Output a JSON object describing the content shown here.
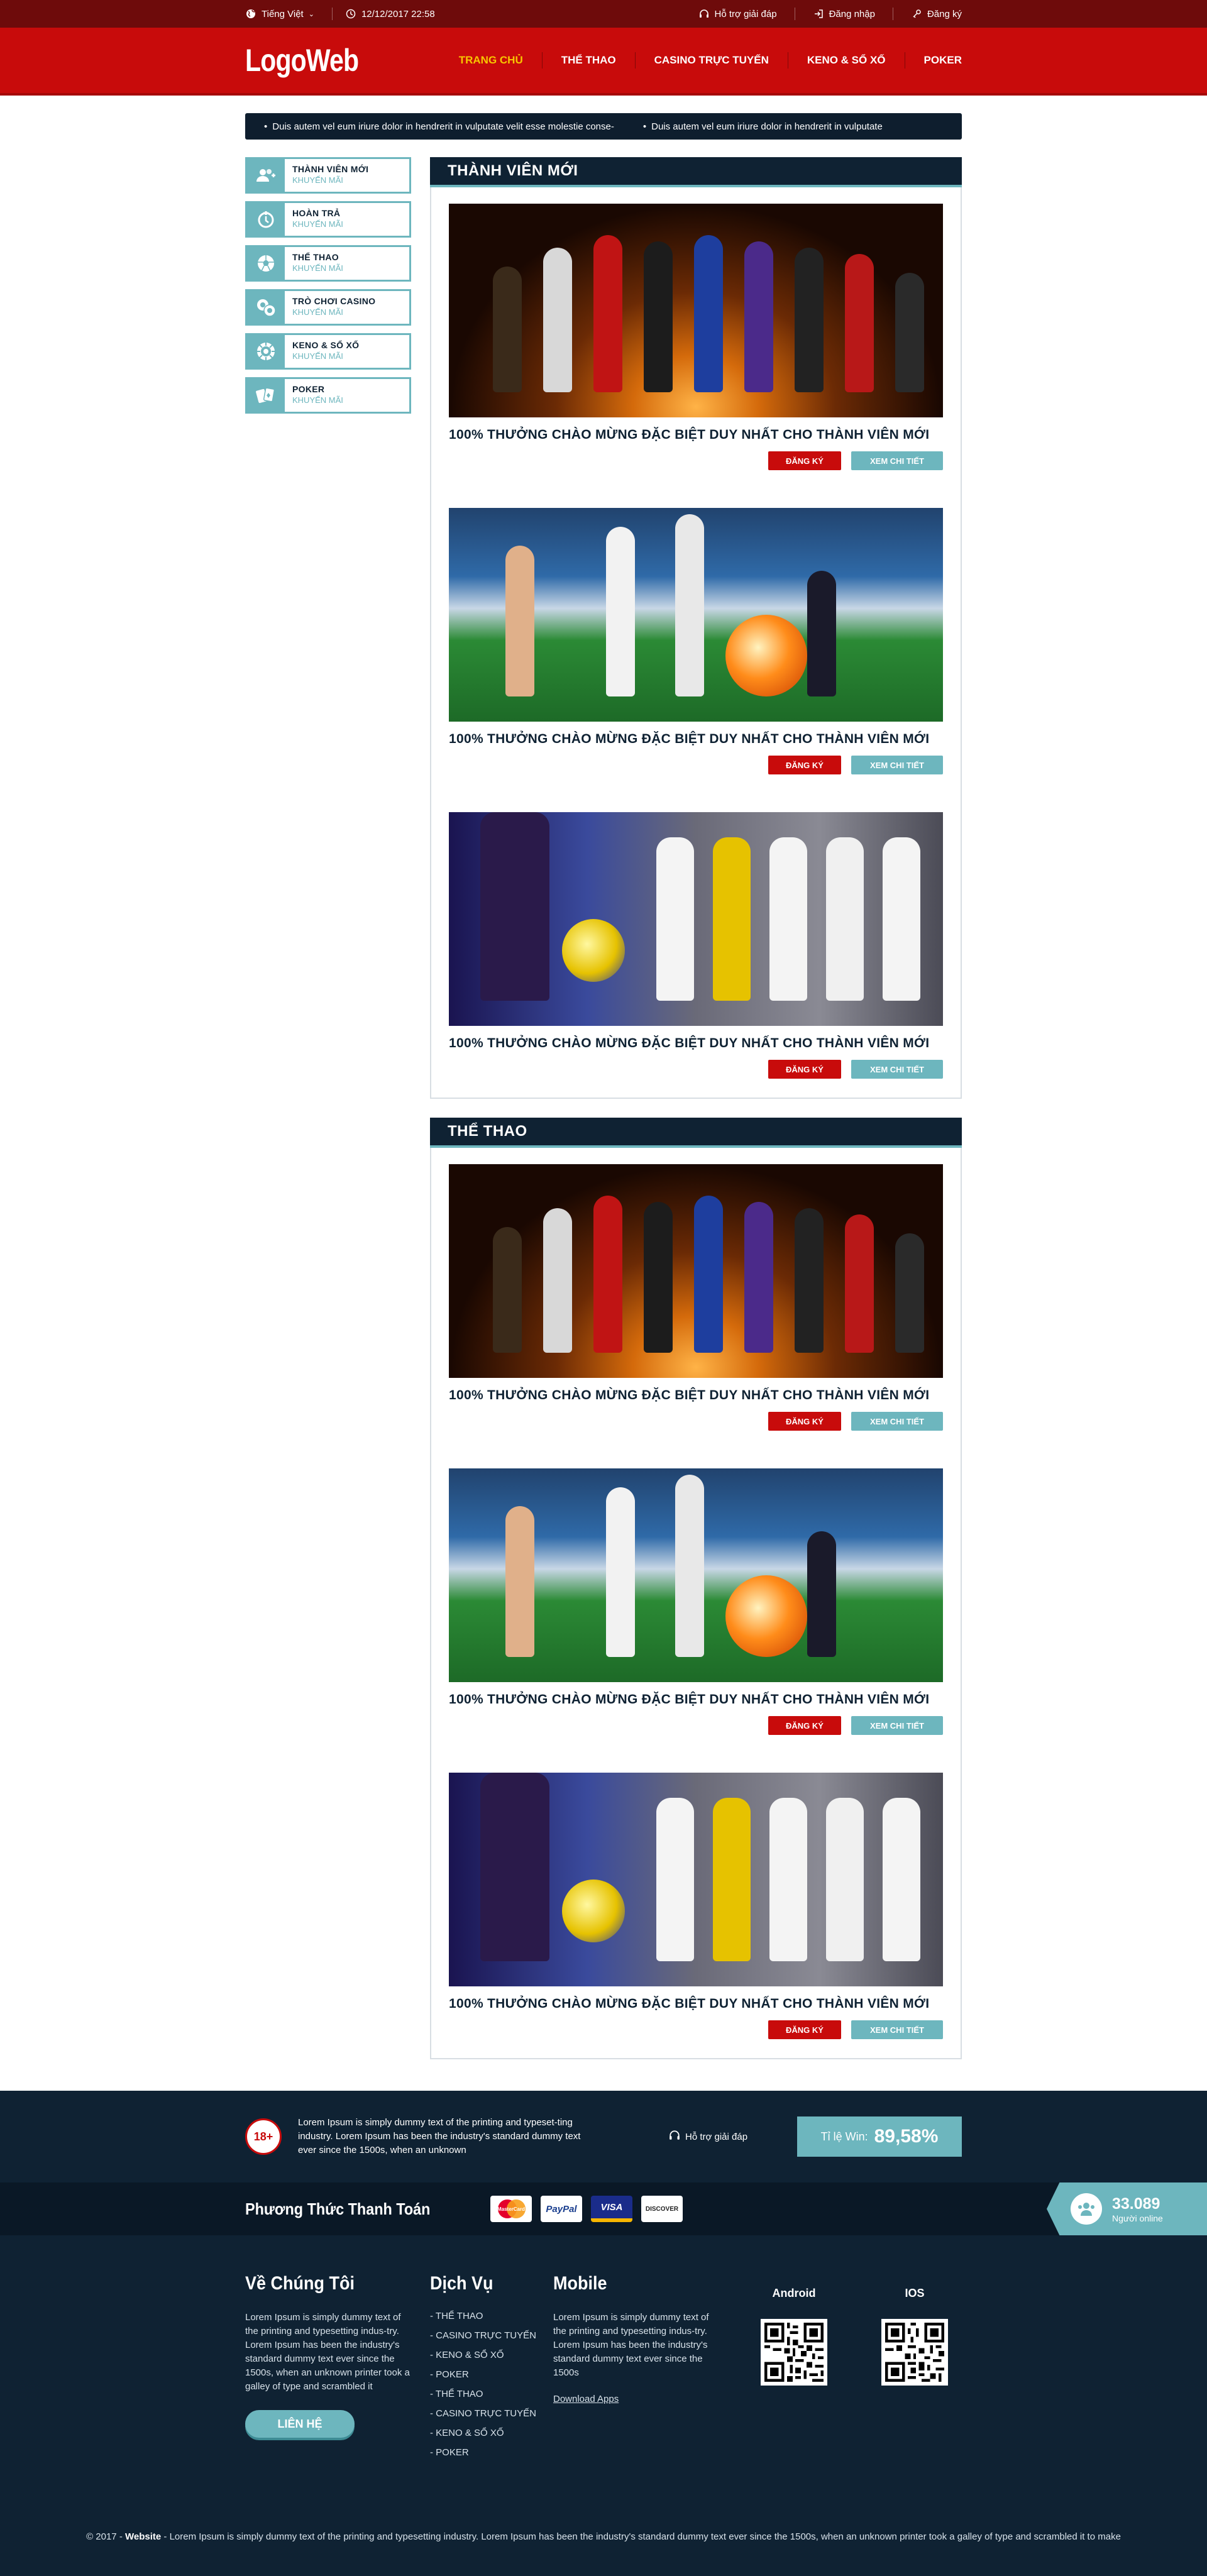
{
  "topbar": {
    "language": "Tiếng Việt",
    "datetime": "12/12/2017 22:58",
    "support": "Hỗ trợ giải đáp",
    "login": "Đăng nhập",
    "register": "Đăng ký"
  },
  "header": {
    "logo": "LogoWeb",
    "nav": [
      "TRANG CHỦ",
      "THỂ THAO",
      "CASINO TRỰC TUYẾN",
      "KENO & SỔ XỐ",
      "POKER"
    ]
  },
  "ticker": [
    "Duis autem vel eum iriure dolor in hendrerit in vulputate velit esse molestie conse-",
    "Duis autem vel eum iriure dolor in hendrerit in vulputate"
  ],
  "sidebar": {
    "items": [
      {
        "title": "THÀNH VIÊN MỚI",
        "sub": "KHUYẾN MÃI",
        "icon": "users-plus-icon"
      },
      {
        "title": "HOÀN TRẢ",
        "sub": "KHUYẾN MÃI",
        "icon": "refund-icon"
      },
      {
        "title": "THỂ THAO",
        "sub": "KHUYẾN MÃI",
        "icon": "soccer-ball-icon"
      },
      {
        "title": "TRÒ CHƠI CASINO",
        "sub": "KHUYẾN MÃI",
        "icon": "casino-chips-icon"
      },
      {
        "title": "KENO & SỔ XỐ",
        "sub": "KHUYẾN MÃI",
        "icon": "lottery-icon"
      },
      {
        "title": "POKER",
        "sub": "KHUYẾN MÃI",
        "icon": "playing-cards-icon"
      }
    ]
  },
  "sections": [
    {
      "title": "THÀNH VIÊN MỚI",
      "cards": [
        {
          "title": "100% THƯỞNG CHÀO MỪNG ĐẶC BIỆT DUY NHẤT CHO THÀNH VIÊN MỚI",
          "btn1": "ĐĂNG KÝ",
          "btn2": "XEM CHI TIẾT"
        },
        {
          "title": "100% THƯỞNG CHÀO MỪNG ĐẶC BIỆT DUY NHẤT CHO THÀNH VIÊN MỚI",
          "btn1": "ĐĂNG KÝ",
          "btn2": "XEM CHI TIẾT"
        },
        {
          "title": "100% THƯỞNG CHÀO MỪNG ĐẶC BIỆT DUY NHẤT CHO THÀNH VIÊN MỚI",
          "btn1": "ĐĂNG KÝ",
          "btn2": "XEM CHI TIẾT"
        }
      ]
    },
    {
      "title": "THỂ THAO",
      "cards": [
        {
          "title": "100% THƯỞNG CHÀO MỪNG ĐẶC BIỆT DUY NHẤT CHO THÀNH VIÊN MỚI",
          "btn1": "ĐĂNG KÝ",
          "btn2": "XEM CHI TIẾT"
        },
        {
          "title": "100% THƯỞNG CHÀO MỪNG ĐẶC BIỆT DUY NHẤT CHO THÀNH VIÊN MỚI",
          "btn1": "ĐĂNG KÝ",
          "btn2": "XEM CHI TIẾT"
        },
        {
          "title": "100% THƯỞNG CHÀO MỪNG ĐẶC BIỆT DUY NHẤT CHO THÀNH VIÊN MỚI",
          "btn1": "ĐĂNG KÝ",
          "btn2": "XEM CHI TIẾT"
        }
      ]
    }
  ],
  "footer": {
    "age_badge": "18+",
    "notice": "Lorem Ipsum is simply dummy text of the printing and typeset-ting industry. Lorem Ipsum has been the industry's standard dummy text ever since the 1500s, when an unknown",
    "support": "Hỗ trợ giải đáp",
    "win_label": "Tỉ lệ Win:",
    "win_value": "89,58%",
    "payment_title": "Phương Thức Thanh Toán",
    "payments": [
      "MasterCard",
      "PayPal",
      "VISA",
      "DISCOVER"
    ],
    "online_count": "33.089",
    "online_label": "Người online",
    "about_title": "Về Chúng Tôi",
    "about_text": "Lorem Ipsum is simply dummy text of the printing and typesetting indus-try. Lorem Ipsum has been the industry's standard dummy text ever since the 1500s, when an unknown printer took a galley of type and scrambled it",
    "contact_button": "LIÊN HỆ",
    "services_title": "Dịch Vụ",
    "services": [
      "THỂ THAO",
      "CASINO TRỰC TUYẾN",
      "KENO & SỔ XỐ",
      "POKER",
      "THỂ THAO",
      "CASINO TRỰC TUYẾN",
      "KENO & SỔ XỐ",
      "POKER"
    ],
    "mobile_title": "Mobile",
    "mobile_text": "Lorem Ipsum is simply dummy text of the printing and typesetting indus-try. Lorem Ipsum has been the industry's standard dummy text ever since the 1500s",
    "download_link": "Download Apps",
    "android_label": "Android",
    "ios_label": "IOS",
    "copyright_prefix": "© 2017 - ",
    "copyright_site": "Website",
    "copyright_text": " - Lorem Ipsum is simply dummy text of the printing and typesetting industry. Lorem Ipsum has been the industry's standard dummy text ever since the 1500s, when an unknown printer took a galley of type and scrambled it to make"
  },
  "colors": {
    "topbar": "#6e0b0b",
    "header": "#c80b0b",
    "navy": "#0f2233",
    "teal": "#6db6be",
    "active_nav": "#f7c600"
  }
}
